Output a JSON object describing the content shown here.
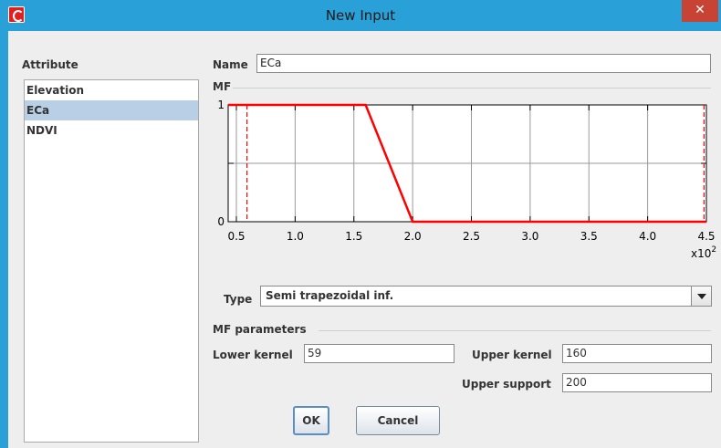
{
  "window": {
    "title": "New Input",
    "close_glyph": "✕",
    "accent_color": "#2aa0d8"
  },
  "attributes": {
    "label": "Attribute",
    "items": [
      {
        "label": "Elevation",
        "selected": false
      },
      {
        "label": "ECa",
        "selected": true
      },
      {
        "label": "NDVI",
        "selected": false
      }
    ]
  },
  "name": {
    "label": "Name",
    "value": "ECa"
  },
  "mf": {
    "label": "MF"
  },
  "chart_data": {
    "type": "line",
    "x_multiplier_label": "x10",
    "x_multiplier_exp": "2",
    "x_ticks": [
      "0.5",
      "1.0",
      "1.5",
      "2.0",
      "2.5",
      "3.0",
      "3.5",
      "4.0",
      "4.5"
    ],
    "y_ticks": [
      "0",
      "1"
    ],
    "xlim": [
      0.43,
      4.5
    ],
    "ylim": [
      0,
      1
    ],
    "series": [
      {
        "x": [
          0.43,
          1.6,
          2.0,
          4.5
        ],
        "y": [
          1,
          1,
          0,
          0
        ],
        "color": "#ff0000"
      }
    ],
    "range_markers": [
      0.59,
      4.48
    ],
    "grid": true
  },
  "type": {
    "label": "Type",
    "value": "Semi trapezoidal inf."
  },
  "mf_parameters": {
    "label": "MF parameters",
    "lower_kernel_label": "Lower kernel",
    "lower_kernel_value": "59",
    "upper_kernel_label": "Upper kernel",
    "upper_kernel_value": "160",
    "upper_support_label": "Upper support",
    "upper_support_value": "200"
  },
  "buttons": {
    "ok": "OK",
    "cancel": "Cancel"
  }
}
